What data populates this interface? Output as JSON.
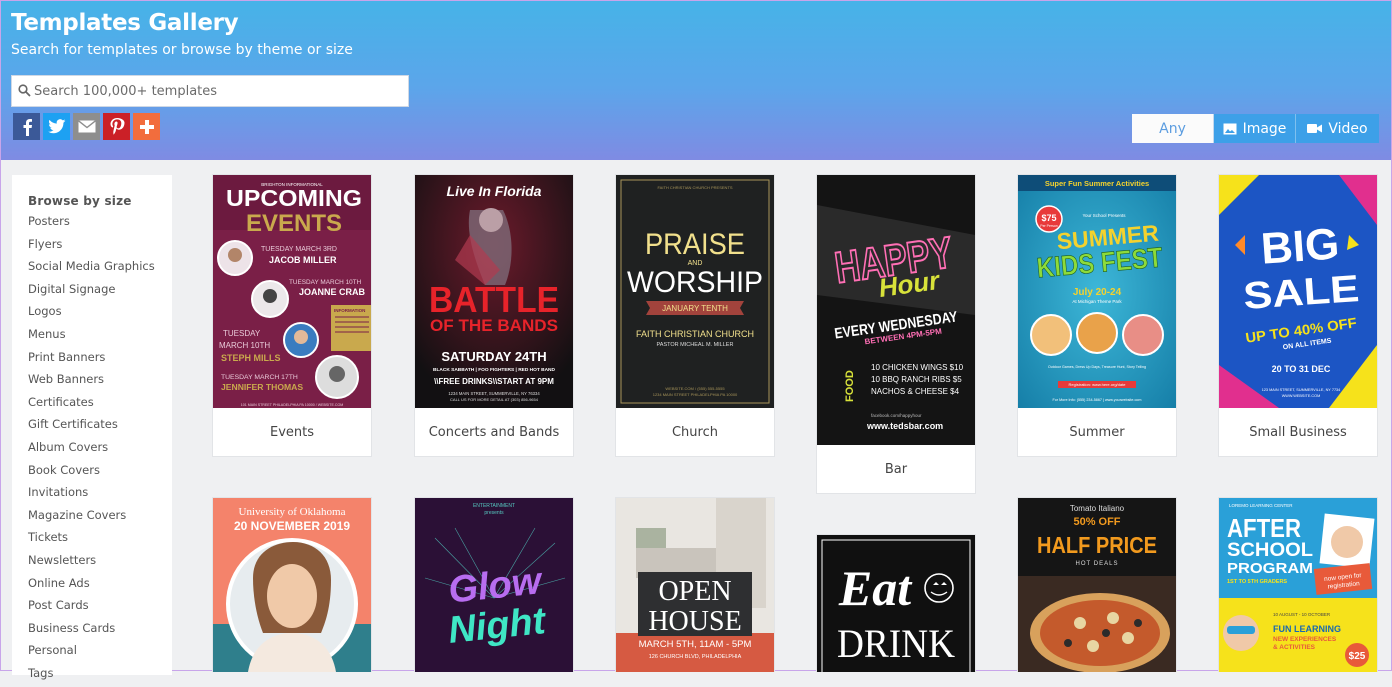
{
  "header": {
    "title": "Templates Gallery",
    "subtitle": "Search for templates or browse by theme or size",
    "search_placeholder": "Search 100,000+ templates"
  },
  "social": [
    {
      "name": "facebook",
      "icon": "facebook-icon",
      "color": "#3b5998"
    },
    {
      "name": "twitter",
      "icon": "twitter-icon",
      "color": "#1da1f2"
    },
    {
      "name": "email",
      "icon": "email-icon",
      "color": "#8e8e8e"
    },
    {
      "name": "pinterest",
      "icon": "pinterest-icon",
      "color": "#cb2027"
    },
    {
      "name": "share-more",
      "icon": "plus-icon",
      "color": "#f26d3d"
    }
  ],
  "filters": {
    "any": "Any",
    "image": "Image",
    "video": "Video"
  },
  "sidebar": {
    "heading": "Browse by size",
    "items": [
      "Posters",
      "Flyers",
      "Social Media Graphics",
      "Digital Signage",
      "Logos",
      "Menus",
      "Print Banners",
      "Web Banners",
      "Certificates",
      "Gift Certificates",
      "Album Covers",
      "Book Covers",
      "Invitations",
      "Magazine Covers",
      "Tickets",
      "Newsletters",
      "Online Ads",
      "Post Cards",
      "Business Cards",
      "Personal",
      "Tags"
    ]
  },
  "cards": [
    {
      "label": "Events",
      "lines": [
        "BRIGHTON INFORMATIONAL",
        "UPCOMING",
        "EVENTS",
        "TUESDAY MARCH 3RD",
        "JACOB MILLER",
        "TUESDAY MARCH 10TH",
        "JOANNE CRAB",
        "INFORMATION",
        "TUESDAY",
        "MARCH 10TH",
        "STEPH MILLS",
        "TUESDAY MARCH 17TH",
        "JENNIFER THOMAS",
        "101 MAIN STREET PHILADELPHIA PA 10000 / WEBSITE.COM"
      ]
    },
    {
      "label": "Concerts and Bands",
      "lines": [
        "Live In Florida",
        "BATTLE",
        "OF THE BANDS",
        "SATURDAY 24TH",
        "BLACK SABBATH | FOO FIGHTERS | RED HOT BAND",
        "\\\\FREE DRINKS\\\\START AT 9PM",
        "1234 MAIN STREET, SUMMERVILLE, NY 76334",
        "CALL US FOR MORE DETAIL AT (303) 856-9654"
      ]
    },
    {
      "label": "Church",
      "lines": [
        "FAITH CHRISTIAN CHURCH PRESENTS",
        "PRAISE",
        "AND",
        "WORSHIP",
        "JANUARY TENTH",
        "FAITH CHRISTIAN CHURCH",
        "PASTOR MICHEAL M. MILLER",
        "WEBSITE.COM / (555) 555-5555",
        "1234 MAIN STREET PHILADELPHIA PA 10000"
      ]
    },
    {
      "label": "Bar",
      "lines": [
        "HAPPY",
        "Hour",
        "EVERY WEDNESDAY",
        "BETWEEN 4PM-5PM",
        "FOOD",
        "10 CHICKEN WINGS $10",
        "10 BBQ RANCH RIBS $5",
        "NACHOS & CHEESE $4",
        "facebook.com/happyhour",
        "www.tedsbar.com"
      ]
    },
    {
      "label": "Summer",
      "lines": [
        "Super Fun Summer Activities",
        "$75",
        "Per Person",
        "Your School Presents",
        "SUMMER",
        "KIDS FEST",
        "July 20-24",
        "At Michigan Theme Park",
        "Outdoor Games, Dress Up Days, Treasure Hunt, Story Telling",
        "Registration: www.here.org/date",
        "For More Info: (555) 234-5867 | www.yourwebsite.com"
      ]
    },
    {
      "label": "Small Business",
      "lines": [
        "BIG",
        "SALE",
        "UP TO 40% OFF",
        "ON ALL ITEMS",
        "20 TO 31 DEC",
        "123 MAIN STREET, SUMMERVILLE, NY 7734",
        "WWW.WEBSITE.COM"
      ]
    },
    {
      "label": "",
      "lines": [
        "University of Oklahoma",
        "20 NOVEMBER 2019"
      ]
    },
    {
      "label": "",
      "lines": [
        "ENTERTAINMENT",
        "presents",
        "Glow",
        "Night"
      ]
    },
    {
      "label": "",
      "lines": [
        "OPEN",
        "HOUSE",
        "MARCH 5TH, 11AM - 5PM",
        "126 CHURCH BLVD, PHILADELPHIA"
      ]
    },
    {
      "label": "",
      "lines": [
        "Eat",
        "DRINK"
      ]
    },
    {
      "label": "",
      "lines": [
        "Tomato Italiano",
        "50% OFF",
        "HALF PRICE",
        "HOT DEALS"
      ]
    },
    {
      "label": "",
      "lines": [
        "LOREMO LEARNING CENTER",
        "AFTER",
        "SCHOOL",
        "PROGRAM",
        "1ST TO 5TH GRADERS",
        "now open for",
        "registration",
        "10 AUGUST - 10 OCTOBER",
        "FUN LEARNING",
        "NEW EXPERIENCES",
        "& ACTIVITIES",
        "$25"
      ]
    }
  ]
}
